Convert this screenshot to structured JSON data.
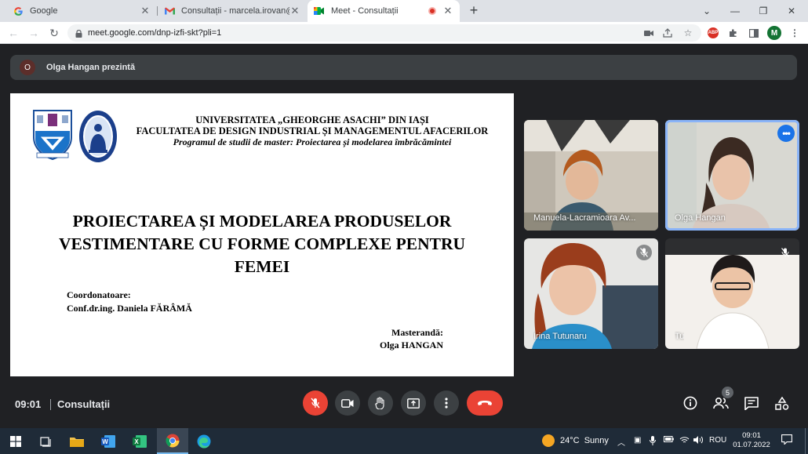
{
  "browser": {
    "tabs": [
      {
        "title": "Google",
        "active": false
      },
      {
        "title": "Consultații - marcela.irovan@gm",
        "active": false
      },
      {
        "title": "Meet - Consultații",
        "active": true
      }
    ],
    "url": "meet.google.com/dnp-izfi-skt?pli=1",
    "profile_initial": "M",
    "adblock_label": "ABP"
  },
  "meet": {
    "presenter_initial": "O",
    "presenting_text": "Olga Hangan prezintă",
    "slide": {
      "university": "UNIVERSITATEA „GHEORGHE ASACHI” DIN IAȘI",
      "faculty": "FACULTATEA DE DESIGN INDUSTRIAL ȘI MANAGEMENTUL AFACERILOR",
      "program": "Programul de studii de master: Proiectarea și modelarea îmbrăcămintei",
      "thesis_title_l1": "PROIECTAREA ȘI MODELAREA PRODUSELOR",
      "thesis_title_l2": "VESTIMENTARE CU FORME COMPLEXE PENTRU",
      "thesis_title_l3": "FEMEI",
      "coordinator_label": "Coordonatoare:",
      "coordinator_name": "Conf.dr.ing. Daniela FĂRÂMĂ",
      "student_label": "Masterandă:",
      "student_name": "Olga HANGAN"
    },
    "participants": [
      {
        "name": "Manuela-Lacramioara Av...",
        "muted": false,
        "speaking": false
      },
      {
        "name": "Olga Hangan",
        "muted": false,
        "speaking": true
      },
      {
        "name": "Irina Tutunaru",
        "muted": true,
        "speaking": false
      },
      {
        "name": "Tu",
        "muted": true,
        "speaking": false
      }
    ],
    "time": "09:01",
    "meeting_name": "Consultații",
    "participant_count": "5",
    "colors": {
      "accent": "#8ab4f8",
      "hangup": "#ea4335",
      "background": "#202124"
    }
  },
  "taskbar": {
    "apps": [
      "start-icon",
      "task-view-icon",
      "file-explorer-icon",
      "word-icon",
      "excel-icon",
      "chrome-icon",
      "edge-icon"
    ],
    "temperature": "24°C",
    "weather": "Sunny",
    "language": "ROU",
    "clock_time": "09:01",
    "clock_date": "01.07.2022"
  }
}
